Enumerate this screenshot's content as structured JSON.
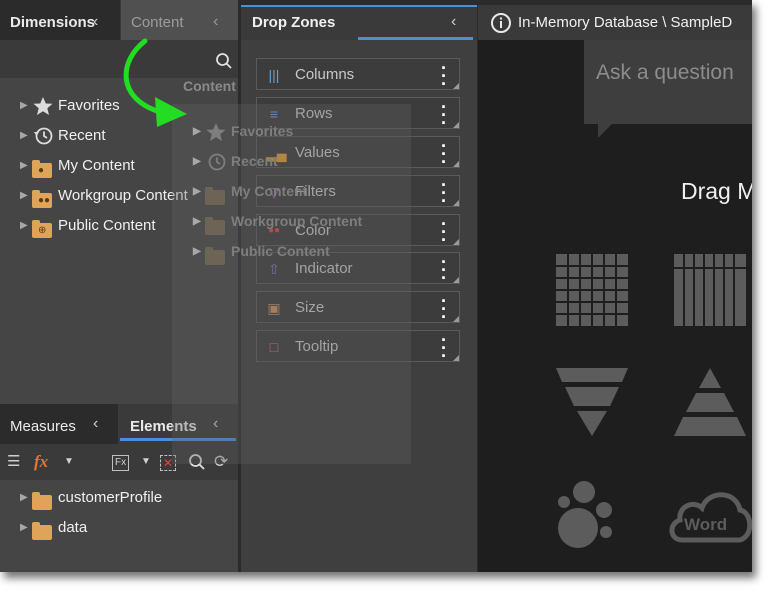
{
  "colors": {
    "accent": "#4a90d9",
    "drag_arrow": "#22dd22",
    "folder": "#e0a458"
  },
  "top_tabs": {
    "dimensions": "Dimensions",
    "content": "Content"
  },
  "drag_ghost": {
    "label": "Content",
    "items": [
      "Favorites",
      "Recent",
      "My Content",
      "Workgroup Content",
      "Public Content"
    ]
  },
  "content_tree": {
    "items": [
      {
        "label": "Favorites",
        "icon": "star-icon"
      },
      {
        "label": "Recent",
        "icon": "history-icon"
      },
      {
        "label": "My Content",
        "icon": "user-folder-icon"
      },
      {
        "label": "Workgroup Content",
        "icon": "group-folder-icon"
      },
      {
        "label": "Public Content",
        "icon": "globe-folder-icon"
      }
    ]
  },
  "drop_zones": {
    "title": "Drop Zones",
    "items": [
      {
        "label": "Columns",
        "icon": "columns-icon"
      },
      {
        "label": "Rows",
        "icon": "rows-icon"
      },
      {
        "label": "Values",
        "icon": "values-icon"
      },
      {
        "label": "Filters",
        "icon": "filter-icon"
      },
      {
        "label": "Color",
        "icon": "color-icon"
      },
      {
        "label": "Indicator",
        "icon": "indicator-icon"
      },
      {
        "label": "Size",
        "icon": "size-icon"
      },
      {
        "label": "Tooltip",
        "icon": "tooltip-icon"
      }
    ]
  },
  "canvas": {
    "title": "In-Memory Database \\ SampleD",
    "ask_placeholder": "Ask a question",
    "drag_text": "Drag M",
    "word_cloud_label": "Word"
  },
  "bottom_tabs": {
    "measures": "Measures",
    "elements": "Elements"
  },
  "elements_tree": {
    "items": [
      {
        "label": "customerProfile",
        "icon": "folder-icon"
      },
      {
        "label": "data",
        "icon": "folder-icon"
      }
    ]
  }
}
